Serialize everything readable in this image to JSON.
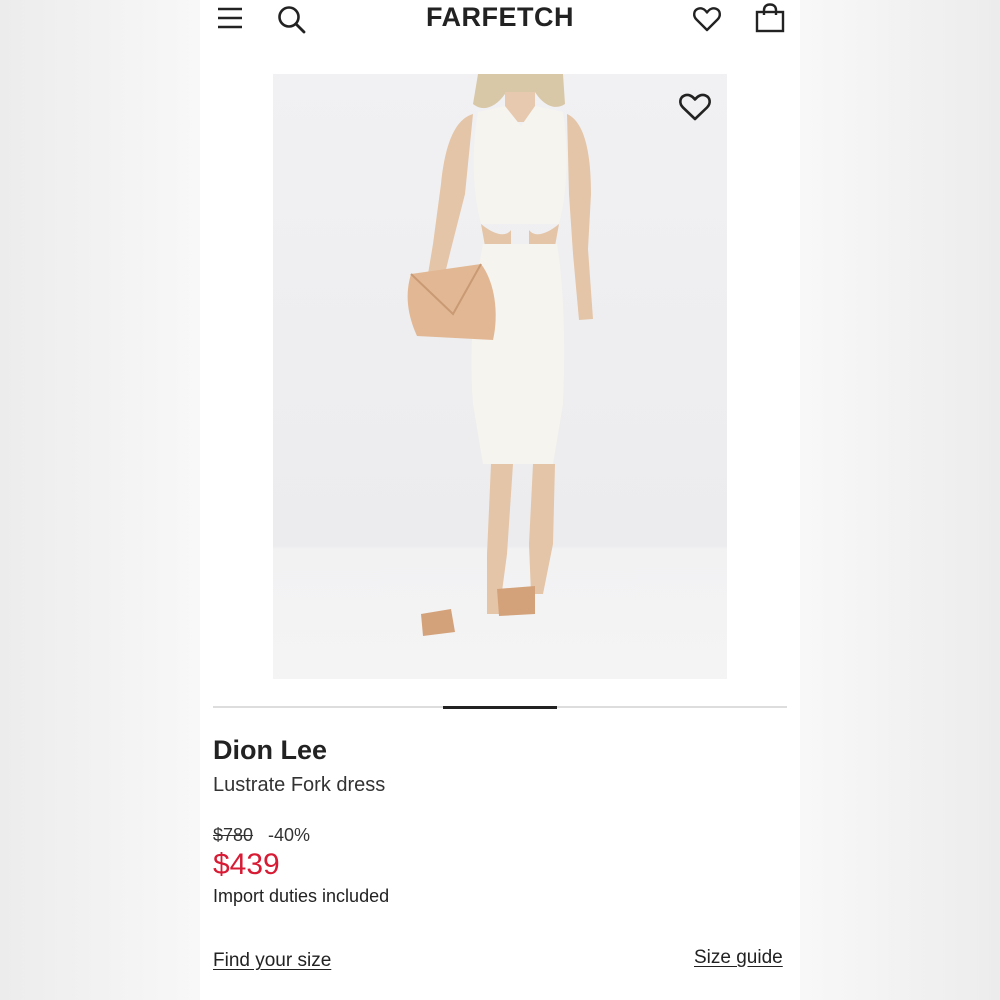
{
  "header": {
    "logo": "FARFETCH",
    "icons": {
      "menu": "menu-icon",
      "search": "search-icon",
      "wishlist": "heart-icon",
      "bag": "shopping-bag-icon"
    }
  },
  "gallery": {
    "wishlist_icon": "heart-icon",
    "image_description": "model in white sleeveless cut-out midi dress holding tan clutch",
    "progress_fraction": 0.2
  },
  "product": {
    "brand": "Dion Lee",
    "name": "Lustrate Fork dress",
    "original_price": "$780",
    "discount": "-40%",
    "sale_price": "$439",
    "duties_note": "Import duties included"
  },
  "links": {
    "find_size": "Find your size",
    "size_guide": "Size guide"
  },
  "colors": {
    "sale_price": "#d81b34",
    "text": "#222222",
    "background": "#ffffff"
  }
}
